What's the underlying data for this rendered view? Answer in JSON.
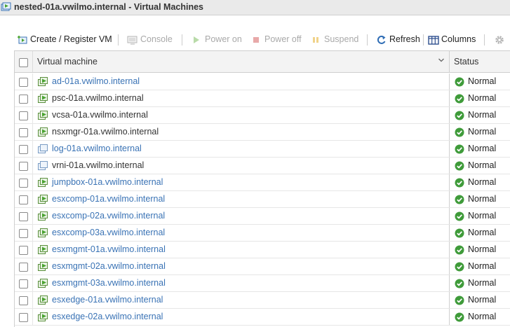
{
  "window": {
    "title": "nested-01a.vwilmo.internal - Virtual Machines"
  },
  "toolbar": {
    "create": "Create / Register VM",
    "console": "Console",
    "power_on": "Power on",
    "power_off": "Power off",
    "suspend": "Suspend",
    "refresh": "Refresh",
    "columns": "Columns"
  },
  "table": {
    "headers": {
      "vm": "Virtual machine",
      "status": "Status"
    },
    "rows": [
      {
        "name": "ad-01a.vwilmo.internal",
        "status": "Normal",
        "power": "on",
        "link": true
      },
      {
        "name": "psc-01a.vwilmo.internal",
        "status": "Normal",
        "power": "on",
        "link": false
      },
      {
        "name": "vcsa-01a.vwilmo.internal",
        "status": "Normal",
        "power": "on",
        "link": false
      },
      {
        "name": "nsxmgr-01a.vwilmo.internal",
        "status": "Normal",
        "power": "on",
        "link": false
      },
      {
        "name": "log-01a.vwilmo.internal",
        "status": "Normal",
        "power": "off",
        "link": true
      },
      {
        "name": "vrni-01a.vwilmo.internal",
        "status": "Normal",
        "power": "off",
        "link": false
      },
      {
        "name": "jumpbox-01a.vwilmo.internal",
        "status": "Normal",
        "power": "on",
        "link": true
      },
      {
        "name": "esxcomp-01a.vwilmo.internal",
        "status": "Normal",
        "power": "on",
        "link": true
      },
      {
        "name": "esxcomp-02a.vwilmo.internal",
        "status": "Normal",
        "power": "on",
        "link": true
      },
      {
        "name": "esxcomp-03a.vwilmo.internal",
        "status": "Normal",
        "power": "on",
        "link": true
      },
      {
        "name": "esxmgmt-01a.vwilmo.internal",
        "status": "Normal",
        "power": "on",
        "link": true
      },
      {
        "name": "esxmgmt-02a.vwilmo.internal",
        "status": "Normal",
        "power": "on",
        "link": true
      },
      {
        "name": "esxmgmt-03a.vwilmo.internal",
        "status": "Normal",
        "power": "on",
        "link": true
      },
      {
        "name": "esxedge-01a.vwilmo.internal",
        "status": "Normal",
        "power": "on",
        "link": true
      },
      {
        "name": "esxedge-02a.vwilmo.internal",
        "status": "Normal",
        "power": "on",
        "link": true
      }
    ]
  },
  "icons": {
    "vm_on": "vm-powered-on-icon",
    "vm_off": "vm-powered-off-icon",
    "status_ok": "check-circle-icon"
  },
  "colors": {
    "link": "#3a73b5",
    "ok_green": "#3f9b3a",
    "vm_green": "#4aa331"
  }
}
